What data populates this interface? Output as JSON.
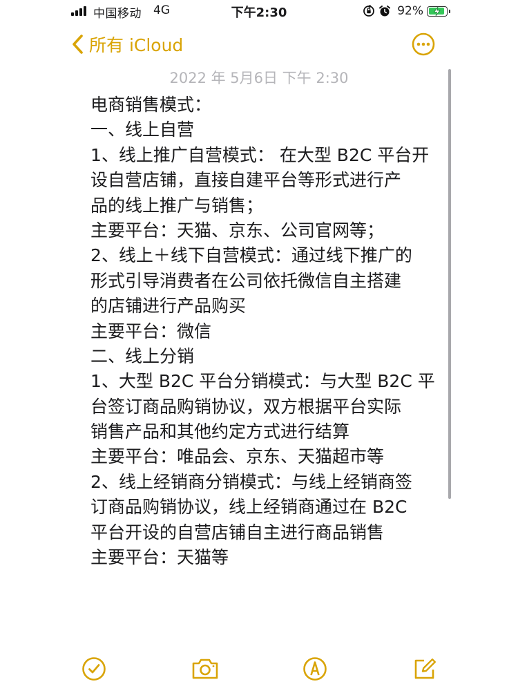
{
  "status_bar": {
    "carrier": "中国移动",
    "network": "4G",
    "time": "下午2:30",
    "battery_percent": "92%",
    "battery_level": 0.92,
    "icons": [
      "signal-bars-icon",
      "orientation-lock-icon",
      "alarm-icon",
      "battery-charging-icon"
    ]
  },
  "nav": {
    "back_label": "所有 iCloud",
    "back_icon": "chevron-left-icon",
    "more_icon": "ellipsis-circle-icon"
  },
  "note": {
    "date": "2022 年 5月6日 下午 2:30",
    "lines": [
      "电商销售模式：",
      "一、线上自营",
      "1、线上推广自营模式： 在大型 B2C 平台开",
      "设自营店铺，直接自建平台等形式进行产",
      "品的线上推广与销售；",
      "主要平台：天猫、京东、公司官网等；",
      "2、线上＋线下自营模式：通过线下推广的",
      "形式引导消费者在公司依托微信自主搭建",
      "的店铺进行产品购买",
      "主要平台：微信",
      "二、线上分销",
      "1、大型 B2C 平台分销模式：与大型 B2C 平",
      "台签订商品购销协议，双方根据平台实际",
      "销售产品和其他约定方式进行结算",
      "主要平台：唯品会、京东、天猫超市等",
      "2、线上经销商分销模式：与线上经销商签",
      "订商品购销协议，线上经销商通过在 B2C",
      "平台开设的自营店铺自主进行商品销售",
      "主要平台：天猫等"
    ]
  },
  "toolbar": {
    "icons": [
      "checklist-icon",
      "camera-icon",
      "markup-pen-icon",
      "compose-icon"
    ]
  },
  "colors": {
    "accent": "#d9a406",
    "battery": "#34c759",
    "date_text": "#b5b5b9",
    "body_text": "#1c1c1e"
  }
}
